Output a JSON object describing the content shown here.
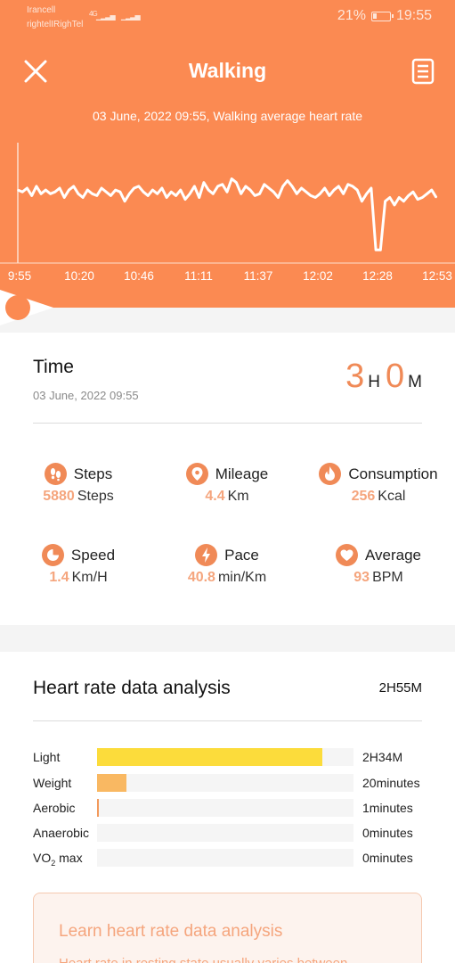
{
  "status_bar": {
    "carrier_1": "Irancell",
    "carrier_2": "rightelIRighTel",
    "network": "4G",
    "battery": "21%",
    "time": "19:55"
  },
  "header": {
    "title": "Walking",
    "close_icon": "close-icon",
    "report_icon": "report-icon"
  },
  "chart_data": {
    "type": "line",
    "title": "03 June, 2022 09:55, Walking average heart rate",
    "x_tick_labels": [
      "9:55",
      "10:20",
      "10:46",
      "11:11",
      "11:37",
      "12:02",
      "12:28",
      "12:53"
    ],
    "xlabel": "",
    "ylabel": "",
    "grid": false,
    "series": [
      {
        "values": [
          94,
          93,
          95,
          91,
          96,
          92,
          94,
          92,
          93,
          95,
          90,
          94,
          96,
          92,
          90,
          94,
          92,
          91,
          95,
          93,
          91,
          94,
          93,
          88,
          92,
          95,
          96,
          93,
          91,
          94,
          92,
          95,
          90,
          93,
          91,
          94,
          89,
          92,
          96,
          90,
          98,
          94,
          92,
          96,
          97,
          93,
          100,
          98,
          92,
          96,
          94,
          91,
          92,
          97,
          95,
          93,
          90,
          96,
          99,
          96,
          92,
          95,
          93,
          91,
          90,
          92,
          95,
          91,
          94,
          96,
          92,
          97,
          96,
          94,
          88,
          92,
          95,
          62,
          62,
          88,
          90,
          86,
          90,
          88,
          91,
          93,
          89,
          90,
          92,
          94,
          90
        ]
      }
    ],
    "line_color": "#ffffff"
  },
  "time_card": {
    "label": "Time",
    "date": "03 June, 2022 09:55",
    "hours": "3",
    "hours_unit": "H",
    "minutes": "0",
    "minutes_unit": "M"
  },
  "stats": [
    {
      "name": "Steps",
      "value": "5880",
      "unit": "Steps",
      "icon": "footprints-icon"
    },
    {
      "name": "Mileage",
      "value": "4.4",
      "unit": "Km",
      "icon": "location-pin-icon"
    },
    {
      "name": "Consumption",
      "value": "256",
      "unit": "Kcal",
      "icon": "flame-icon"
    },
    {
      "name": "Speed",
      "value": "1.4",
      "unit": "Km/H",
      "icon": "speedometer-icon"
    },
    {
      "name": "Pace",
      "value": "40.8",
      "unit": "min/Km",
      "icon": "lightning-icon"
    },
    {
      "name": "Average",
      "value": "93",
      "unit": "BPM",
      "icon": "heart-icon"
    }
  ],
  "heart_rate": {
    "title": "Heart rate data analysis",
    "total": "2H55M",
    "zones": [
      {
        "label": "Light",
        "value": "2H34M",
        "fraction": 0.88,
        "color": "#fcdc3b"
      },
      {
        "label": "Weight",
        "value": "20minutes",
        "fraction": 0.114,
        "color": "#f9b862"
      },
      {
        "label": "Aerobic",
        "value": "1minutes",
        "fraction": 0.006,
        "color": "#f39a5c"
      },
      {
        "label": "Anaerobic",
        "value": "0minutes",
        "fraction": 0,
        "color": "#f08a57"
      },
      {
        "label": "VO",
        "sub": "2",
        "suffix": " max",
        "value": "0minutes",
        "fraction": 0,
        "color": "#e9704a"
      }
    ]
  },
  "learn": {
    "title": "Learn heart rate data analysis",
    "text": "Heart rate in resting state usually varies between"
  },
  "colors": {
    "accent": "#fb8a52",
    "value_highlight": "#f5a57d"
  }
}
